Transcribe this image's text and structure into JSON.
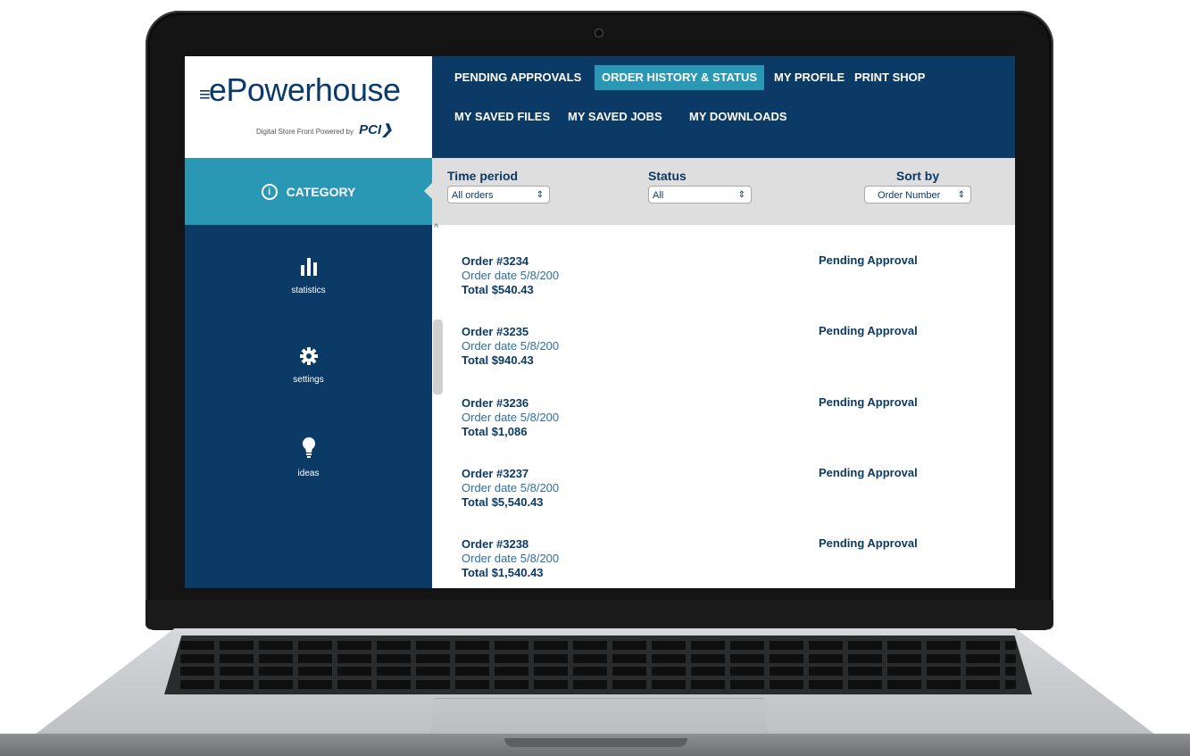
{
  "brand": {
    "logo_prefix": "≡",
    "logo_text": "ePowerhouse",
    "tagline": "Digital Store Front Powered by",
    "tagline_brand": "PCI❯"
  },
  "topnav": {
    "items": [
      {
        "label": "PENDING  APPROVALS",
        "active": false
      },
      {
        "label": "ORDER HISTORY & STATUS",
        "active": true
      },
      {
        "label": "MY PROFILE",
        "active": false
      },
      {
        "label": "PRINT SHOP",
        "active": false
      },
      {
        "label": "MY SAVED FILES",
        "active": false
      },
      {
        "label": "MY SAVED JOBS",
        "active": false
      },
      {
        "label": "MY DOWNLOADS",
        "active": false
      }
    ]
  },
  "sidebar": {
    "category_label": "CATEGORY",
    "info_glyph": "i",
    "items": [
      {
        "label": "statistics",
        "icon": "bar-chart-icon"
      },
      {
        "label": "settings",
        "icon": "gear-icon"
      },
      {
        "label": "ideas",
        "icon": "lightbulb-icon"
      }
    ]
  },
  "filters": {
    "time_period": {
      "title": "Time period",
      "value": "All orders"
    },
    "status": {
      "title": "Status",
      "value": "All"
    },
    "sort_by": {
      "title": "Sort by",
      "value": "Order Number"
    }
  },
  "orders": [
    {
      "number": "Order #3234",
      "date": "Order date 5/8/200",
      "total": "Total $540.43",
      "status": "Pending Approval"
    },
    {
      "number": "Order #3235",
      "date": "Order date 5/8/200",
      "total": "Total $940.43",
      "status": "Pending Approval"
    },
    {
      "number": "Order #3236",
      "date": "Order date 5/8/200",
      "total": "Total $1,086",
      "status": "Pending Approval"
    },
    {
      "number": "Order #3237",
      "date": "Order date 5/8/200",
      "total": "Total $5,540.43",
      "status": "Pending Approval"
    },
    {
      "number": "Order #3238",
      "date": "Order date 5/8/200",
      "total": "Total $1,540.43",
      "status": "Pending Approval"
    }
  ],
  "colors": {
    "navy": "#0c3a66",
    "teal": "#2a97b5",
    "filter_bg": "#dedede"
  }
}
